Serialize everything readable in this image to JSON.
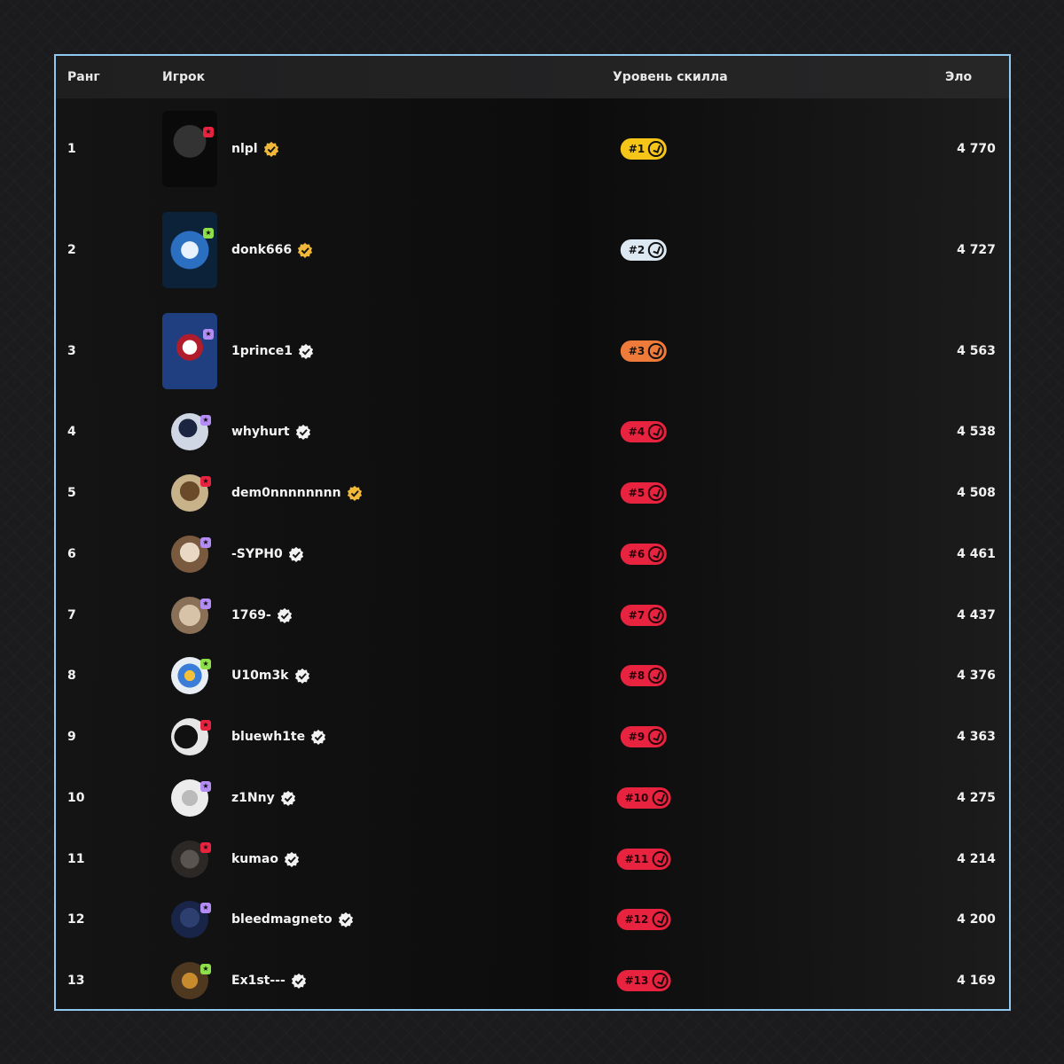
{
  "header": {
    "rank": "Ранг",
    "player": "Игрок",
    "skill": "Уровень скилла",
    "elo": "Эло"
  },
  "colors": {
    "border": "#8fc9f0",
    "gold": "#f5c518",
    "silver": "#dde9f2",
    "bronze": "#ee7b3a",
    "red": "#e8233f"
  },
  "rows": [
    {
      "rank": "1",
      "name": "nlpl",
      "skill": "#1",
      "elo": "4 770",
      "verified": "gold",
      "tier": "gold",
      "avatar": "square",
      "badge": "red"
    },
    {
      "rank": "2",
      "name": "donk666",
      "skill": "#2",
      "elo": "4 727",
      "verified": "gold",
      "tier": "silver",
      "avatar": "square",
      "badge": "green"
    },
    {
      "rank": "3",
      "name": "1prince1",
      "skill": "#3",
      "elo": "4 563",
      "verified": "white",
      "tier": "bronze",
      "avatar": "square",
      "badge": "purple"
    },
    {
      "rank": "4",
      "name": "whyhurt",
      "skill": "#4",
      "elo": "4 538",
      "verified": "white",
      "tier": "red",
      "avatar": "circle",
      "badge": "purple"
    },
    {
      "rank": "5",
      "name": "dem0nnnnnnnn",
      "skill": "#5",
      "elo": "4 508",
      "verified": "gold",
      "tier": "red",
      "avatar": "circle",
      "badge": "red"
    },
    {
      "rank": "6",
      "name": "-SYPH0",
      "skill": "#6",
      "elo": "4 461",
      "verified": "white",
      "tier": "red",
      "avatar": "circle",
      "badge": "purple"
    },
    {
      "rank": "7",
      "name": "1769-",
      "skill": "#7",
      "elo": "4 437",
      "verified": "white",
      "tier": "red",
      "avatar": "circle",
      "badge": "purple"
    },
    {
      "rank": "8",
      "name": "U10m3k",
      "skill": "#8",
      "elo": "4 376",
      "verified": "white",
      "tier": "red",
      "avatar": "circle",
      "badge": "green"
    },
    {
      "rank": "9",
      "name": "bluewh1te",
      "skill": "#9",
      "elo": "4 363",
      "verified": "white",
      "tier": "red",
      "avatar": "circle",
      "badge": "red"
    },
    {
      "rank": "10",
      "name": "z1Nny",
      "skill": "#10",
      "elo": "4 275",
      "verified": "white",
      "tier": "red",
      "avatar": "circle",
      "badge": "purple"
    },
    {
      "rank": "11",
      "name": "kumao",
      "skill": "#11",
      "elo": "4 214",
      "verified": "white",
      "tier": "red",
      "avatar": "circle",
      "badge": "red"
    },
    {
      "rank": "12",
      "name": "bleedmagneto",
      "skill": "#12",
      "elo": "4 200",
      "verified": "white",
      "tier": "red",
      "avatar": "circle",
      "badge": "purple"
    },
    {
      "rank": "13",
      "name": "Ex1st---",
      "skill": "#13",
      "elo": "4 169",
      "verified": "white",
      "tier": "red",
      "avatar": "circle",
      "badge": "green"
    }
  ]
}
